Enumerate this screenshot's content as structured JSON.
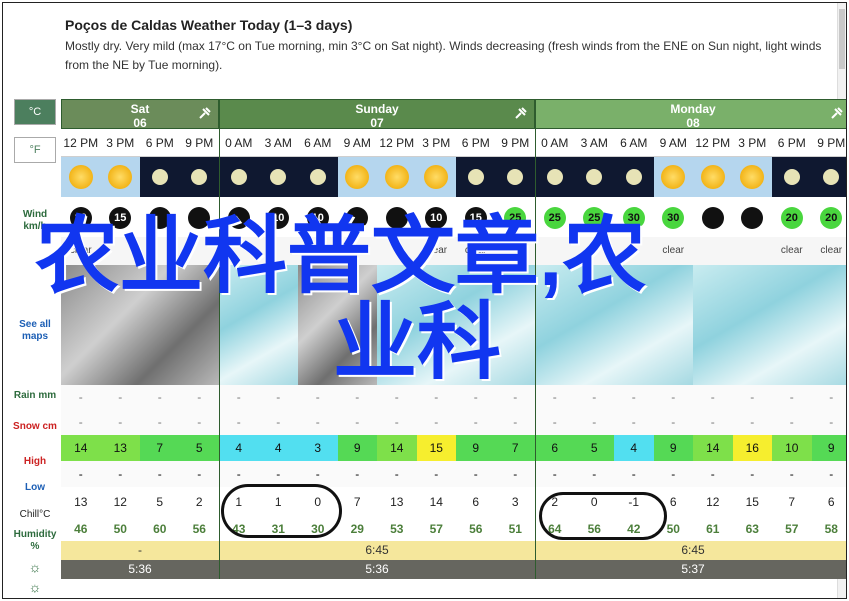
{
  "header": {
    "title": "Poços de Caldas Weather Today (1–3 days)",
    "description": "Mostly dry. Very mild (max 17°C on Tue morning, min 3°C on Sat night). Winds decreasing (fresh winds from the ENE on Sun night, light winds from the NE by Tue morning)."
  },
  "units": {
    "celsius": "°C",
    "fahrenheit": "°F"
  },
  "labels": {
    "wind": "Wind km/h",
    "see_all_maps": "See all maps",
    "rain": "Rain mm",
    "snow": "Snow cm",
    "high": "High",
    "low": "Low",
    "chill": "Chill°C",
    "humidity": "Humidity %"
  },
  "days": [
    {
      "name": "Sat",
      "date": "06",
      "color": "#6b8c5a"
    },
    {
      "name": "Sunday",
      "date": "07",
      "color": "#5a8a4c"
    },
    {
      "name": "Monday",
      "date": "08",
      "color": "#7ab06a"
    }
  ],
  "hours": [
    "12 PM",
    "3 PM",
    "6 PM",
    "9 PM",
    "0 AM",
    "3 AM",
    "6 AM",
    "9 AM",
    "12 PM",
    "3 PM",
    "6 PM",
    "9 PM",
    "0 AM",
    "3 AM",
    "6 AM",
    "9 AM",
    "12 PM",
    "3 PM",
    "6 PM",
    "9 PM"
  ],
  "sky": [
    "day",
    "day",
    "night",
    "night",
    "night",
    "night",
    "night",
    "day",
    "day",
    "day",
    "night",
    "night",
    "night",
    "night",
    "night",
    "day",
    "day",
    "day",
    "night",
    "night"
  ],
  "wind": [
    "10",
    "15",
    "",
    "",
    "",
    "10",
    "10",
    "",
    "",
    "10",
    "15",
    "25",
    "25",
    "25",
    "30",
    "30",
    "",
    "",
    "20",
    "20"
  ],
  "wind_green": [
    false,
    false,
    false,
    false,
    false,
    false,
    false,
    false,
    false,
    false,
    false,
    true,
    true,
    true,
    true,
    true,
    false,
    false,
    true,
    true
  ],
  "conditions": [
    "clear",
    "",
    "",
    "",
    "",
    "",
    "clear",
    "",
    "",
    "clear",
    "clear",
    "",
    "",
    "",
    "",
    "clear",
    "",
    "",
    "clear",
    "clear"
  ],
  "rain": [
    "-",
    "-",
    "-",
    "-",
    "-",
    "-",
    "-",
    "-",
    "-",
    "-",
    "-",
    "-",
    "-",
    "-",
    "-",
    "-",
    "-",
    "-",
    "-",
    "-"
  ],
  "snow": [
    "-",
    "-",
    "-",
    "-",
    "-",
    "-",
    "-",
    "-",
    "-",
    "-",
    "-",
    "-",
    "-",
    "-",
    "-",
    "-",
    "-",
    "-",
    "-",
    "-"
  ],
  "high": [
    "14",
    "13",
    "7",
    "5",
    "4",
    "4",
    "3",
    "9",
    "14",
    "15",
    "9",
    "7",
    "6",
    "5",
    "4",
    "9",
    "14",
    "16",
    "10",
    "9"
  ],
  "high_colors": [
    "#7ee04a",
    "#7ee04a",
    "#55d955",
    "#55d955",
    "#52dff0",
    "#52dff0",
    "#52dff0",
    "#55d955",
    "#7ee04a",
    "#f6ee2e",
    "#55d955",
    "#55d955",
    "#55d955",
    "#55d955",
    "#52dff0",
    "#55d955",
    "#7ee04a",
    "#f6ee2e",
    "#7ee04a",
    "#55d955"
  ],
  "low": [
    "-",
    "-",
    "-",
    "-",
    "-",
    "-",
    "-",
    "-",
    "-",
    "-",
    "-",
    "-",
    "-",
    "-",
    "-",
    "-",
    "-",
    "-",
    "-",
    "-"
  ],
  "chill": [
    "13",
    "12",
    "5",
    "2",
    "1",
    "1",
    "0",
    "7",
    "13",
    "14",
    "6",
    "3",
    "2",
    "0",
    "-1",
    "6",
    "12",
    "15",
    "7",
    "6"
  ],
  "humidity": [
    "46",
    "50",
    "60",
    "56",
    "43",
    "31",
    "30",
    "29",
    "53",
    "57",
    "56",
    "51",
    "64",
    "56",
    "42",
    "50",
    "61",
    "63",
    "57",
    "58"
  ],
  "sunrise": [
    "6:45",
    "6:45"
  ],
  "sunset": [
    "5:36",
    "5:36",
    "5:37"
  ],
  "watermark": [
    "农业科普文章,农",
    "业科"
  ]
}
